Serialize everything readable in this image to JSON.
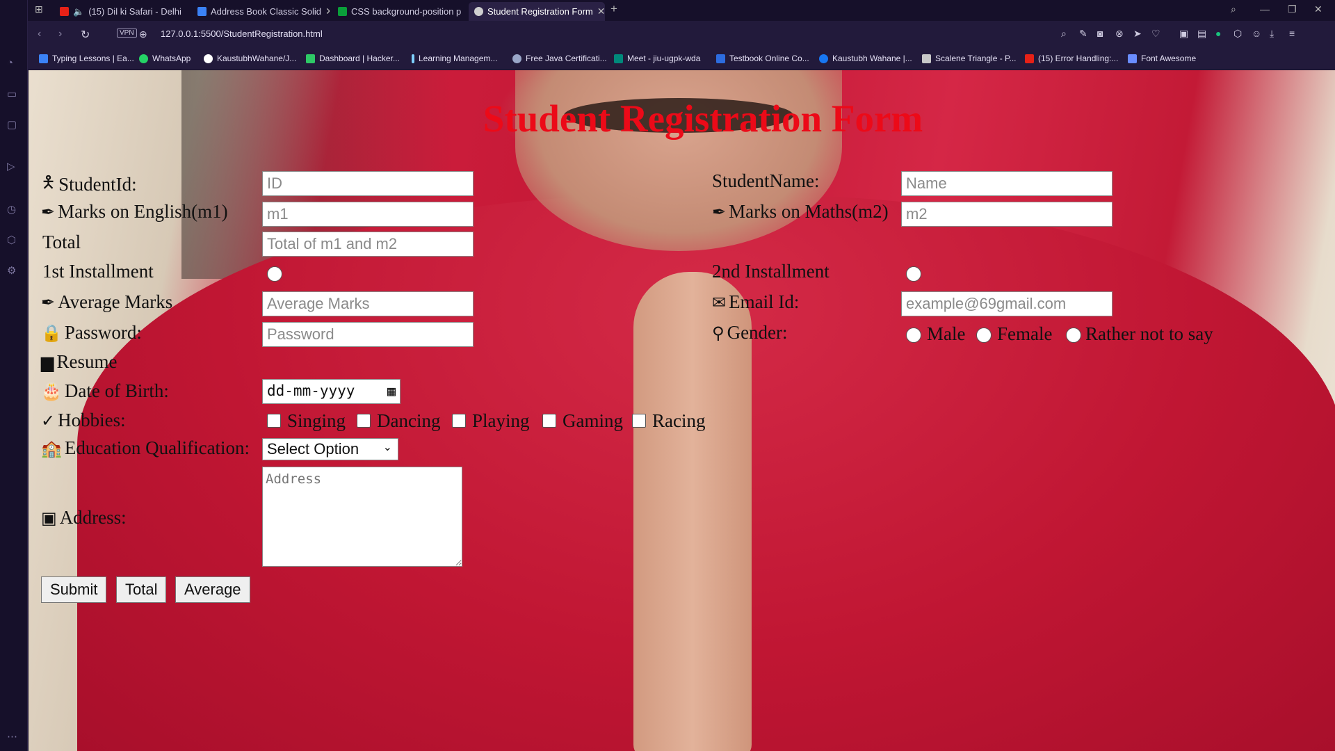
{
  "browser": {
    "tabs": [
      {
        "title": "(15) Dil ki Safari - Delhi",
        "color": "#e62117"
      },
      {
        "title": "Address Book Classic Solid",
        "color": "#3b82f6"
      },
      {
        "title": "CSS background-position p",
        "color": "#0a9e3a"
      },
      {
        "title": "Student Registration Form",
        "color": "#cfcfcf"
      }
    ],
    "new_tab": "+",
    "url": "127.0.0.1:5500/StudentRegistration.html",
    "vpn": "VPN",
    "bookmarks": [
      {
        "label": "Typing Lessons | Ea...",
        "color": "#3b82f6"
      },
      {
        "label": "WhatsApp",
        "color": "#25d366"
      },
      {
        "label": "KaustubhWahane/J...",
        "color": "#ffffff"
      },
      {
        "label": "Dashboard | Hacker...",
        "color": "#2ec866"
      },
      {
        "label": "Learning Managem...",
        "color": "#7fd0ff"
      },
      {
        "label": "Free Java Certificati...",
        "color": "#9aa6c8"
      },
      {
        "label": "Meet - jiu-ugpk-wda",
        "color": "#00897b"
      },
      {
        "label": "Testbook Online Co...",
        "color": "#2d6cdf"
      },
      {
        "label": "Kaustubh Wahane |...",
        "color": "#1877f2"
      },
      {
        "label": "Scalene Triangle - P...",
        "color": "#c8c8c8"
      },
      {
        "label": "(15) Error Handling:...",
        "color": "#e62117"
      },
      {
        "label": "Font Awesome",
        "color": "#6a8dff"
      }
    ]
  },
  "form": {
    "title": "Student Registration Form",
    "student_id_label": "StudentId:",
    "student_id_placeholder": "ID",
    "student_name_label": "StudentName:",
    "student_name_placeholder": "Name",
    "m1_label": "Marks on English(m1)",
    "m1_placeholder": "m1",
    "m2_label": "Marks on Maths(m2)",
    "m2_placeholder": "m2",
    "total_label": "Total",
    "total_placeholder": "Total of m1 and m2",
    "inst1_label": "1st Installment",
    "inst2_label": "2nd Installment",
    "avg_label": "Average Marks",
    "avg_placeholder": "Average Marks",
    "email_label": "Email Id:",
    "email_placeholder": "example@69gmail.com",
    "password_label": "Password:",
    "password_placeholder": "Password",
    "gender_label": "Gender:",
    "gender_options": [
      "Male",
      "Female",
      "Rather not to say"
    ],
    "resume_label": "Resume",
    "dob_label": "Date of Birth:",
    "dob_placeholder": "dd-mm-yyyy",
    "hobbies_label": "Hobbies:",
    "hobbies": [
      "Singing",
      "Dancing",
      "Playing",
      "Gaming",
      "Racing"
    ],
    "edu_label": "Education Qualification:",
    "edu_selected": "Select Option",
    "address_label": "Address:",
    "address_placeholder": "Address",
    "buttons": {
      "submit": "Submit",
      "total": "Total",
      "average": "Average"
    }
  }
}
